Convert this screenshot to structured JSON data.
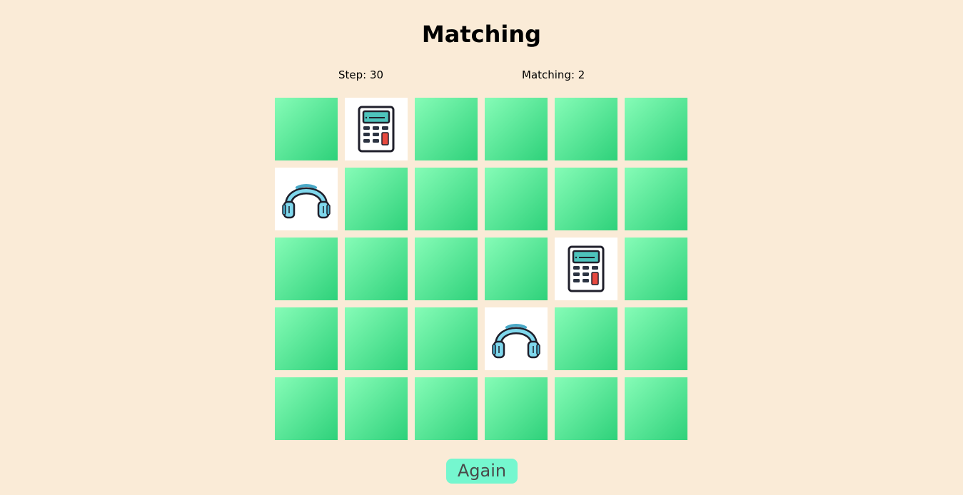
{
  "title": "Matching",
  "stats": {
    "step_label": "Step: 30",
    "matching_label": "Matching: 2"
  },
  "board": {
    "columns": 6,
    "rows": 5,
    "cards": [
      {
        "state": "hidden"
      },
      {
        "state": "revealed",
        "icon": "calculator-icon"
      },
      {
        "state": "hidden"
      },
      {
        "state": "hidden"
      },
      {
        "state": "hidden"
      },
      {
        "state": "hidden"
      },
      {
        "state": "revealed",
        "icon": "headphones-icon"
      },
      {
        "state": "hidden"
      },
      {
        "state": "hidden"
      },
      {
        "state": "hidden"
      },
      {
        "state": "hidden"
      },
      {
        "state": "hidden"
      },
      {
        "state": "hidden"
      },
      {
        "state": "hidden"
      },
      {
        "state": "hidden"
      },
      {
        "state": "hidden"
      },
      {
        "state": "revealed",
        "icon": "calculator-icon"
      },
      {
        "state": "hidden"
      },
      {
        "state": "hidden"
      },
      {
        "state": "hidden"
      },
      {
        "state": "hidden"
      },
      {
        "state": "revealed",
        "icon": "headphones-icon"
      },
      {
        "state": "hidden"
      },
      {
        "state": "hidden"
      },
      {
        "state": "hidden"
      },
      {
        "state": "hidden"
      },
      {
        "state": "hidden"
      },
      {
        "state": "hidden"
      },
      {
        "state": "hidden"
      },
      {
        "state": "hidden"
      }
    ]
  },
  "again_button": "Again",
  "colors": {
    "background": "#faebd7",
    "card_back_light": "#86fcb7",
    "card_back_dark": "#2ed17a",
    "button": "#75f7cf"
  }
}
